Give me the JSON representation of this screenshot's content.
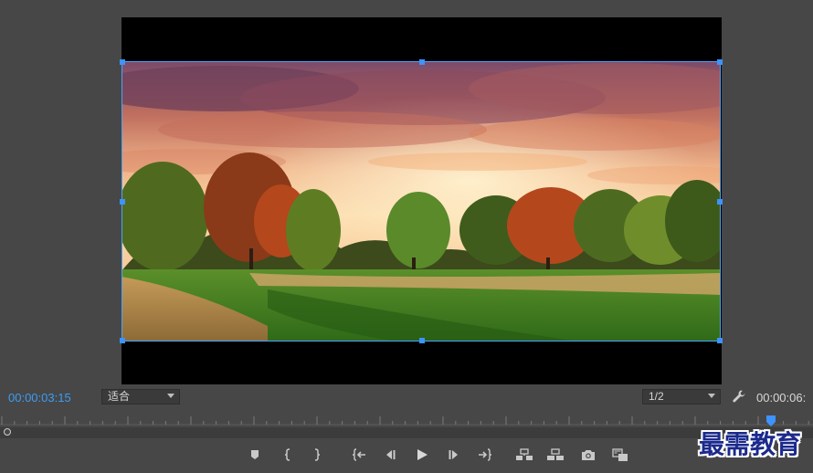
{
  "monitor": {
    "image_description_icon": "autumn-landscape-sunset",
    "selection_color": "#3d93ff"
  },
  "controls": {
    "current_timecode": "00:00:03:15",
    "duration_timecode": "00:00:06:",
    "fit_select_value": "适合",
    "resolution_select_value": "1/2",
    "timecode_accent": "#3c9cf5",
    "playhead_position": 0.95
  },
  "transport": [
    {
      "name": "add-marker-button",
      "icon": "marker-icon"
    },
    {
      "name": "mark-in-button",
      "icon": "mark-in-icon"
    },
    {
      "name": "mark-out-button",
      "icon": "mark-out-icon"
    },
    {
      "name": "go-to-in-button",
      "icon": "go-to-in-icon"
    },
    {
      "name": "step-back-button",
      "icon": "step-back-icon"
    },
    {
      "name": "play-button",
      "icon": "play-icon"
    },
    {
      "name": "step-forward-button",
      "icon": "step-forward-icon"
    },
    {
      "name": "go-to-out-button",
      "icon": "go-to-out-icon"
    },
    {
      "name": "lift-button",
      "icon": "lift-icon"
    },
    {
      "name": "extract-button",
      "icon": "extract-icon"
    },
    {
      "name": "export-frame-button",
      "icon": "camera-icon"
    },
    {
      "name": "comparison-view-button",
      "icon": "comparison-view-icon"
    }
  ],
  "watermark": {
    "text": "最需教育"
  }
}
